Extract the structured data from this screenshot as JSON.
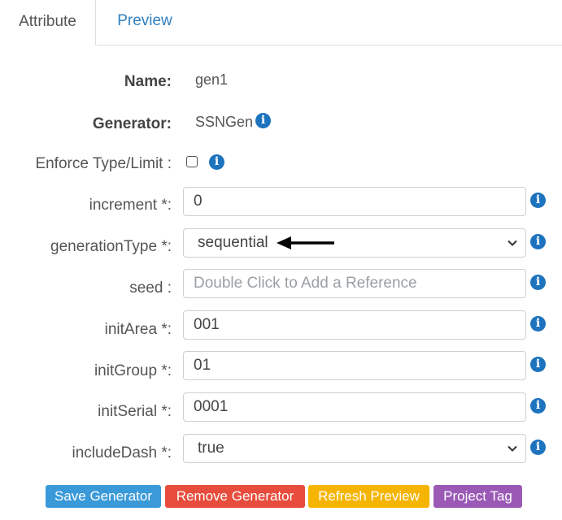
{
  "tabs": [
    {
      "label": "Attribute",
      "active": true
    },
    {
      "label": "Preview",
      "active": false
    }
  ],
  "form": {
    "name": {
      "label": "Name:",
      "value": "gen1"
    },
    "generator": {
      "label": "Generator:",
      "value": "SSNGen"
    },
    "enforce": {
      "label": "Enforce Type/Limit :",
      "checked": false
    },
    "increment": {
      "label": "increment *:",
      "value": "0"
    },
    "generationType": {
      "label": "generationType *:",
      "value": "sequential"
    },
    "seed": {
      "label": "seed :",
      "placeholder": "Double Click to Add a Reference"
    },
    "initArea": {
      "label": "initArea *:",
      "value": "001"
    },
    "initGroup": {
      "label": "initGroup *:",
      "value": "01"
    },
    "initSerial": {
      "label": "initSerial *:",
      "value": "0001"
    },
    "includeDash": {
      "label": "includeDash *:",
      "value": "true"
    }
  },
  "info_glyph": "i",
  "icons": {
    "info": "info-circle-icon",
    "chevron": "chevron-down-icon",
    "arrow": "arrow-left-icon"
  },
  "buttons": {
    "save": {
      "label": "Save Generator",
      "color": "#3a9ad9"
    },
    "remove": {
      "label": "Remove Generator",
      "color": "#e74c3c"
    },
    "refresh": {
      "label": "Refresh Preview",
      "color": "#f5b400"
    },
    "project": {
      "label": "Project Tag",
      "color": "#9b59b6"
    }
  },
  "colors": {
    "info": "#1e73be",
    "tab_link": "#2f7fc1"
  }
}
